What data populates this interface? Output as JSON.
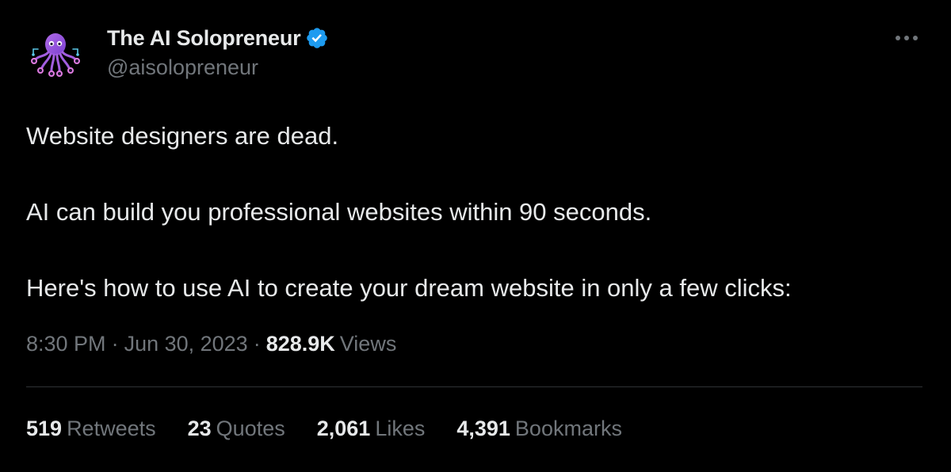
{
  "author": {
    "display_name": "The AI Solopreneur",
    "handle": "@aisolopreneur",
    "avatar_icon": "octopus-icon",
    "verified_icon": "verified-badge-icon",
    "verified_color": "#1d9bf0"
  },
  "more_menu_icon": "ellipsis-icon",
  "tweet": {
    "lines": [
      "Website designers are dead.",
      "AI can build you professional websites within 90 seconds.",
      "Here's how to use AI to create your dream website in only a few clicks:"
    ]
  },
  "meta": {
    "time": "8:30 PM",
    "separator": "·",
    "date": "Jun 30, 2023",
    "views_count": "828.9K",
    "views_label": "Views"
  },
  "stats": [
    {
      "count": "519",
      "label": "Retweets"
    },
    {
      "count": "23",
      "label": "Quotes"
    },
    {
      "count": "2,061",
      "label": "Likes"
    },
    {
      "count": "4,391",
      "label": "Bookmarks"
    }
  ],
  "colors": {
    "background": "#000000",
    "text_primary": "#e7e9ea",
    "text_secondary": "#71767b",
    "divider": "#2f3336"
  }
}
